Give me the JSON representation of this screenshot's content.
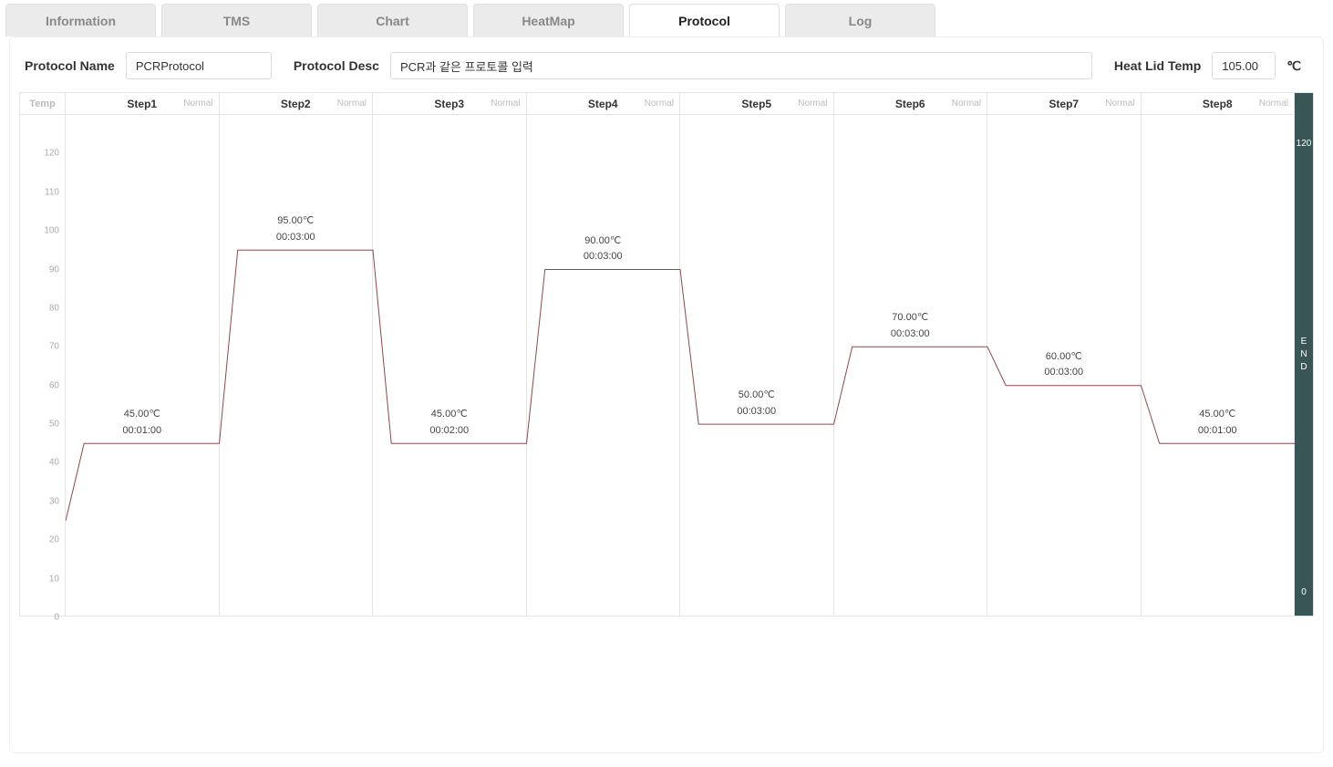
{
  "tabs": [
    {
      "label": "Information",
      "active": false
    },
    {
      "label": "TMS",
      "active": false
    },
    {
      "label": "Chart",
      "active": false
    },
    {
      "label": "HeatMap",
      "active": false
    },
    {
      "label": "Protocol",
      "active": true
    },
    {
      "label": "Log",
      "active": false
    }
  ],
  "form": {
    "protocol_name_label": "Protocol Name",
    "protocol_name_value": "PCRProtocol",
    "protocol_desc_label": "Protocol Desc",
    "protocol_desc_value": "PCR과 같은 프로토콜 입력",
    "heat_lid_label": "Heat Lid Temp",
    "heat_lid_value": "105.00",
    "heat_lid_unit": "℃"
  },
  "chart": {
    "y_axis_label": "Temp",
    "y_ticks": [
      0,
      10,
      20,
      30,
      40,
      50,
      60,
      70,
      80,
      90,
      100,
      110,
      120
    ],
    "end_label": "E\nN\nD",
    "end_top": "120",
    "end_bot": "0"
  },
  "chart_data": {
    "type": "line",
    "title": "",
    "xlabel": "",
    "ylabel": "Temp",
    "ylim": [
      0,
      130
    ],
    "start_temp": 25,
    "steps": [
      {
        "name": "Step1",
        "mode": "Normal",
        "temp": 45.0,
        "temp_label": "45.00℃",
        "time": "00:01:00"
      },
      {
        "name": "Step2",
        "mode": "Normal",
        "temp": 95.0,
        "temp_label": "95.00℃",
        "time": "00:03:00"
      },
      {
        "name": "Step3",
        "mode": "Normal",
        "temp": 45.0,
        "temp_label": "45.00℃",
        "time": "00:02:00"
      },
      {
        "name": "Step4",
        "mode": "Normal",
        "temp": 90.0,
        "temp_label": "90.00℃",
        "time": "00:03:00"
      },
      {
        "name": "Step5",
        "mode": "Normal",
        "temp": 50.0,
        "temp_label": "50.00℃",
        "time": "00:03:00"
      },
      {
        "name": "Step6",
        "mode": "Normal",
        "temp": 70.0,
        "temp_label": "70.00℃",
        "time": "00:03:00"
      },
      {
        "name": "Step7",
        "mode": "Normal",
        "temp": 60.0,
        "temp_label": "60.00℃",
        "time": "00:03:00"
      },
      {
        "name": "Step8",
        "mode": "Normal",
        "temp": 45.0,
        "temp_label": "45.00℃",
        "time": "00:01:00"
      }
    ]
  }
}
